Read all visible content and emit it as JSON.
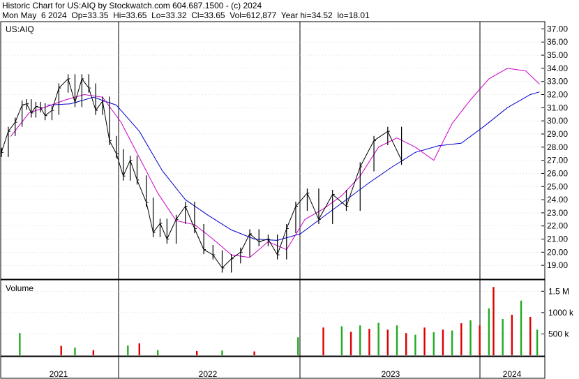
{
  "header": {
    "line1": "Historic Chart for US:AIQ by Stockwatch.com 604.687.1500 - (c) 2024",
    "line2": "Mon May  6 2024  Op=33.35  Hi=33.65  Lo=33.32  Cl=33.65  Vol=612,877  Year hi=34.52  lo=18.01"
  },
  "colors": {
    "price": "#000000",
    "ma_short": "#cc00cc",
    "ma_long": "#0000cc",
    "vol_up": "#22aa22",
    "vol_down": "#dd0000",
    "grid": "#000000"
  },
  "chart_data": [
    {
      "type": "line",
      "title": "US:AIQ",
      "ylim": [
        18.0,
        37.5
      ],
      "yticks": [
        19,
        20,
        21,
        22,
        23,
        24,
        25,
        26,
        27,
        28,
        29,
        30,
        31,
        32,
        33,
        34,
        35,
        36,
        37
      ],
      "ytick_labels": [
        "19.00",
        "20.00",
        "21.00",
        "22.00",
        "23.00",
        "24.00",
        "25.00",
        "26.00",
        "27.00",
        "28.00",
        "29.00",
        "30.00",
        "31.00",
        "32.00",
        "33.00",
        "34.00",
        "35.00",
        "36.00",
        "37.00"
      ],
      "x_labels": [
        "2021",
        "2022",
        "2023",
        "2024"
      ],
      "series": [
        {
          "role": "price",
          "x": [
            0,
            3,
            6,
            9,
            11,
            13,
            15,
            17,
            19,
            22,
            25,
            29,
            32,
            35,
            38,
            41,
            44,
            47,
            50,
            53,
            56,
            59,
            63,
            66,
            69,
            72,
            76,
            80,
            84,
            88,
            92,
            96,
            100,
            104,
            108,
            112,
            116,
            120,
            124,
            128,
            133,
            138,
            144,
            150,
            156,
            162,
            168,
            174
          ],
          "values": [
            27.6,
            29.2,
            29.9,
            31.2,
            31.3,
            30.6,
            31.1,
            31.0,
            30.4,
            30.8,
            32.5,
            33.2,
            31.4,
            33.2,
            32.5,
            30.8,
            31.5,
            28.5,
            27.5,
            25.8,
            27.0,
            25.5,
            23.8,
            21.5,
            22.2,
            21.0,
            22.5,
            23.5,
            21.8,
            20.2,
            19.8,
            18.8,
            19.5,
            20.0,
            21.4,
            20.8,
            21.0,
            19.8,
            21.8,
            23.5,
            24.5,
            22.5,
            24.4,
            23.5,
            26.5,
            28.5,
            29.2,
            27.0
          ]
        },
        {
          "role": "ma_short",
          "x": [
            4,
            12,
            20,
            28,
            36,
            44,
            52,
            60,
            68,
            76,
            84,
            92,
            100,
            108,
            116,
            124,
            132,
            140,
            148,
            156,
            164,
            172,
            180,
            188,
            196,
            204,
            212,
            220,
            228,
            234
          ],
          "values": [
            28.8,
            30.6,
            31.1,
            31.6,
            32.0,
            31.8,
            29.9,
            27.2,
            24.5,
            22.4,
            22.1,
            21.0,
            19.8,
            19.6,
            20.8,
            20.2,
            22.5,
            23.3,
            24.3,
            25.8,
            28.0,
            28.7,
            28.0,
            27.0,
            29.8,
            31.6,
            33.2,
            34.0,
            33.8,
            32.8
          ]
        },
        {
          "role": "ma_long",
          "x": [
            20,
            30,
            40,
            50,
            60,
            70,
            80,
            90,
            100,
            110,
            120,
            130,
            140,
            150,
            160,
            170,
            180,
            190,
            200,
            210,
            220,
            230,
            234
          ],
          "values": [
            31.2,
            31.3,
            31.8,
            31.2,
            29.2,
            26.2,
            24.0,
            22.8,
            21.7,
            21.0,
            20.9,
            21.4,
            22.7,
            24.0,
            25.3,
            26.5,
            27.6,
            28.1,
            28.3,
            29.6,
            31.0,
            32.0,
            32.2
          ]
        }
      ]
    },
    {
      "type": "bar",
      "title": "Volume",
      "ylim": [
        0,
        1750000
      ],
      "yticks": [
        500000,
        1000000,
        1500000
      ],
      "ytick_labels": [
        "500 k",
        "1000 k",
        "1.5 M"
      ],
      "x_labels": [
        "2021",
        "2022",
        "2023",
        "2024"
      ],
      "series": [
        {
          "role": "volume",
          "x": [
            8,
            26,
            32,
            40,
            55,
            60,
            68,
            85,
            96,
            110,
            129,
            140,
            148,
            152,
            156,
            160,
            164,
            168,
            172,
            176,
            180,
            184,
            188,
            192,
            196,
            200,
            204,
            208,
            212,
            214,
            218,
            222,
            226,
            230,
            233
          ],
          "values": [
            520000,
            220000,
            180000,
            120000,
            230000,
            280000,
            120000,
            100000,
            110000,
            90000,
            420000,
            650000,
            680000,
            550000,
            700000,
            620000,
            760000,
            600000,
            700000,
            520000,
            480000,
            650000,
            540000,
            600000,
            580000,
            750000,
            820000,
            700000,
            1100000,
            1600000,
            850000,
            950000,
            1280000,
            900000,
            600000
          ]
        }
      ]
    }
  ]
}
